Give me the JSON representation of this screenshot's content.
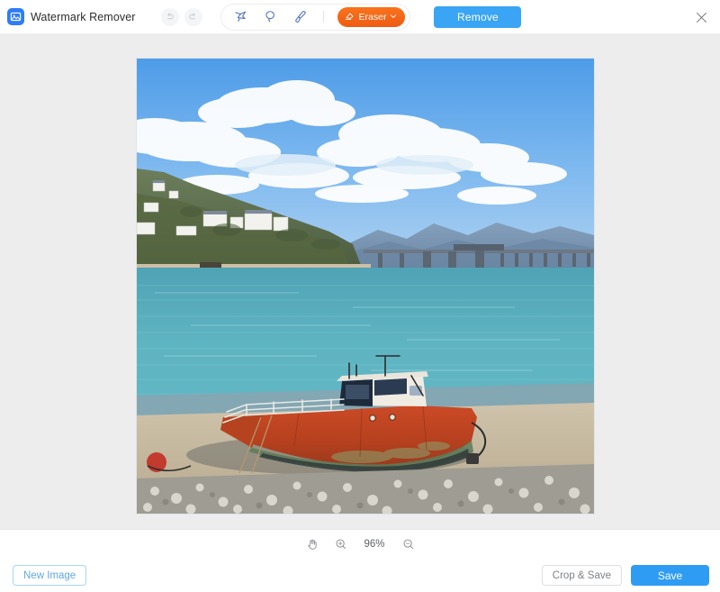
{
  "header": {
    "logo_icon": "photo-app-logo-icon",
    "title": "Watermark Remover",
    "undo_icon": "undo-icon",
    "redo_icon": "redo-icon",
    "tools": [
      {
        "name": "polygonal-lasso-tool",
        "label": "Polygonal Lasso"
      },
      {
        "name": "lasso-tool",
        "label": "Lasso"
      },
      {
        "name": "brush-tool",
        "label": "Brush"
      }
    ],
    "eraser": {
      "label": "Eraser",
      "icon": "eraser-icon",
      "caret": "⌄",
      "color": "#f4651a"
    },
    "remove_label": "Remove",
    "remove_color": "#39a5f4",
    "close_icon": "close-icon"
  },
  "canvas": {
    "background": "#ededed",
    "image_alt": "Red rusty fishing boat beached on a pebble and sand shore with turquoise estuary water, a long railway bridge, hills with white houses and a blue sky with white clouds"
  },
  "zoombar": {
    "pan_icon": "hand-pan-icon",
    "zoom_in_icon": "zoom-in-icon",
    "zoom_level": "96%",
    "zoom_out_icon": "zoom-out-icon"
  },
  "footer": {
    "new_image_label": "New Image",
    "crop_save_label": "Crop & Save",
    "save_label": "Save",
    "save_color": "#2f9cf4"
  }
}
